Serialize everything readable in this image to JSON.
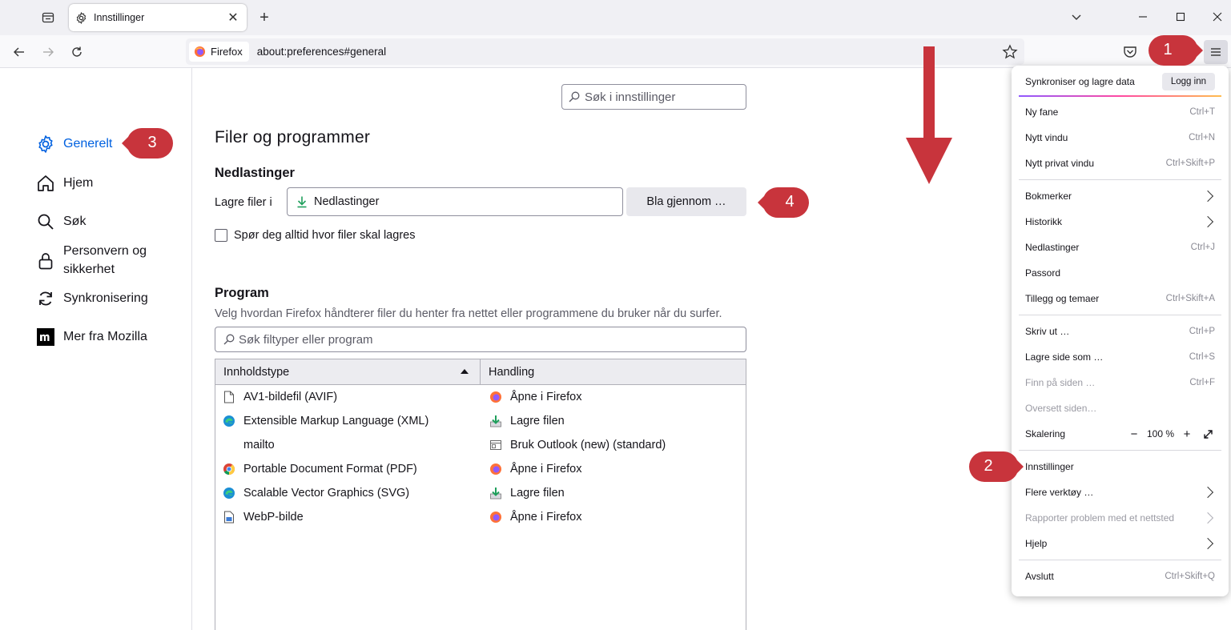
{
  "browser": {
    "tab_title": "Innstillinger",
    "identity_label": "Firefox",
    "url": "about:preferences#general"
  },
  "sidebar": {
    "items": [
      {
        "label": "Generelt",
        "icon": "gear-icon",
        "active": true
      },
      {
        "label": "Hjem",
        "icon": "home-icon"
      },
      {
        "label": "Søk",
        "icon": "search-icon"
      },
      {
        "label": "Personvern og\nsikkerhet",
        "icon": "lock-icon"
      },
      {
        "label": "Synkronisering",
        "icon": "sync-icon"
      },
      {
        "label": "Mer fra Mozilla",
        "icon": "mozilla-icon"
      }
    ]
  },
  "main": {
    "search_placeholder": "Søk i innstillinger",
    "section_title": "Filer og programmer",
    "downloads_heading": "Nedlastinger",
    "save_files_label": "Lagre filer i",
    "download_folder": "Nedlastinger",
    "browse_button": "Bla gjennom …",
    "always_ask_label": "Spør deg alltid hvor filer skal lagres",
    "always_ask_checked": false,
    "program_heading": "Program",
    "program_description": "Velg hvordan Firefox håndterer filer du henter fra nettet eller programmene du bruker når du surfer.",
    "types_search_placeholder": "Søk filtyper eller program",
    "table": {
      "col_type": "Innholdstype",
      "col_action": "Handling",
      "rows": [
        {
          "type": "AV1-bildefil (AVIF)",
          "type_icon": "file-icon",
          "action": "Åpne i Firefox",
          "action_icon": "firefox-icon"
        },
        {
          "type": "Extensible Markup Language (XML)",
          "type_icon": "edge-icon",
          "action": "Lagre filen",
          "action_icon": "save-file-icon"
        },
        {
          "type": "mailto",
          "type_icon": "",
          "action": "Bruk Outlook (new) (standard)",
          "action_icon": "outlook-icon"
        },
        {
          "type": "Portable Document Format (PDF)",
          "type_icon": "chrome-icon",
          "action": "Åpne i Firefox",
          "action_icon": "firefox-icon"
        },
        {
          "type": "Scalable Vector Graphics (SVG)",
          "type_icon": "edge-icon",
          "action": "Lagre filen",
          "action_icon": "save-file-icon"
        },
        {
          "type": "WebP-bilde",
          "type_icon": "image-file-icon",
          "action": "Åpne i Firefox",
          "action_icon": "firefox-icon"
        }
      ]
    }
  },
  "app_menu": {
    "sync_label": "Synkroniser og lagre data",
    "login_button": "Logg inn",
    "items": [
      {
        "label": "Ny fane",
        "key": "Ctrl+T"
      },
      {
        "label": "Nytt vindu",
        "key": "Ctrl+N"
      },
      {
        "label": "Nytt privat vindu",
        "key": "Ctrl+Skift+P"
      },
      {
        "label": "Bokmerker",
        "submenu": true
      },
      {
        "label": "Historikk",
        "submenu": true
      },
      {
        "label": "Nedlastinger",
        "key": "Ctrl+J"
      },
      {
        "label": "Passord"
      },
      {
        "label": "Tillegg og temaer",
        "key": "Ctrl+Skift+A"
      },
      {
        "label": "Skriv ut …",
        "key": "Ctrl+P"
      },
      {
        "label": "Lagre side som …",
        "key": "Ctrl+S"
      },
      {
        "label": "Finn på siden …",
        "key": "Ctrl+F",
        "disabled": true
      },
      {
        "label": "Oversett siden…",
        "disabled": true
      },
      {
        "label": "Skalering"
      },
      {
        "label": "Innstillinger"
      },
      {
        "label": "Flere verktøy …",
        "submenu": true
      },
      {
        "label": "Rapporter problem med et nettsted",
        "submenu": true,
        "disabled": true
      },
      {
        "label": "Hjelp",
        "submenu": true
      },
      {
        "label": "Avslutt",
        "key": "Ctrl+Skift+Q"
      }
    ],
    "zoom_level": "100 %"
  },
  "annotations": {
    "callouts": [
      "1",
      "2",
      "3",
      "4"
    ],
    "color": "#c8343c"
  }
}
